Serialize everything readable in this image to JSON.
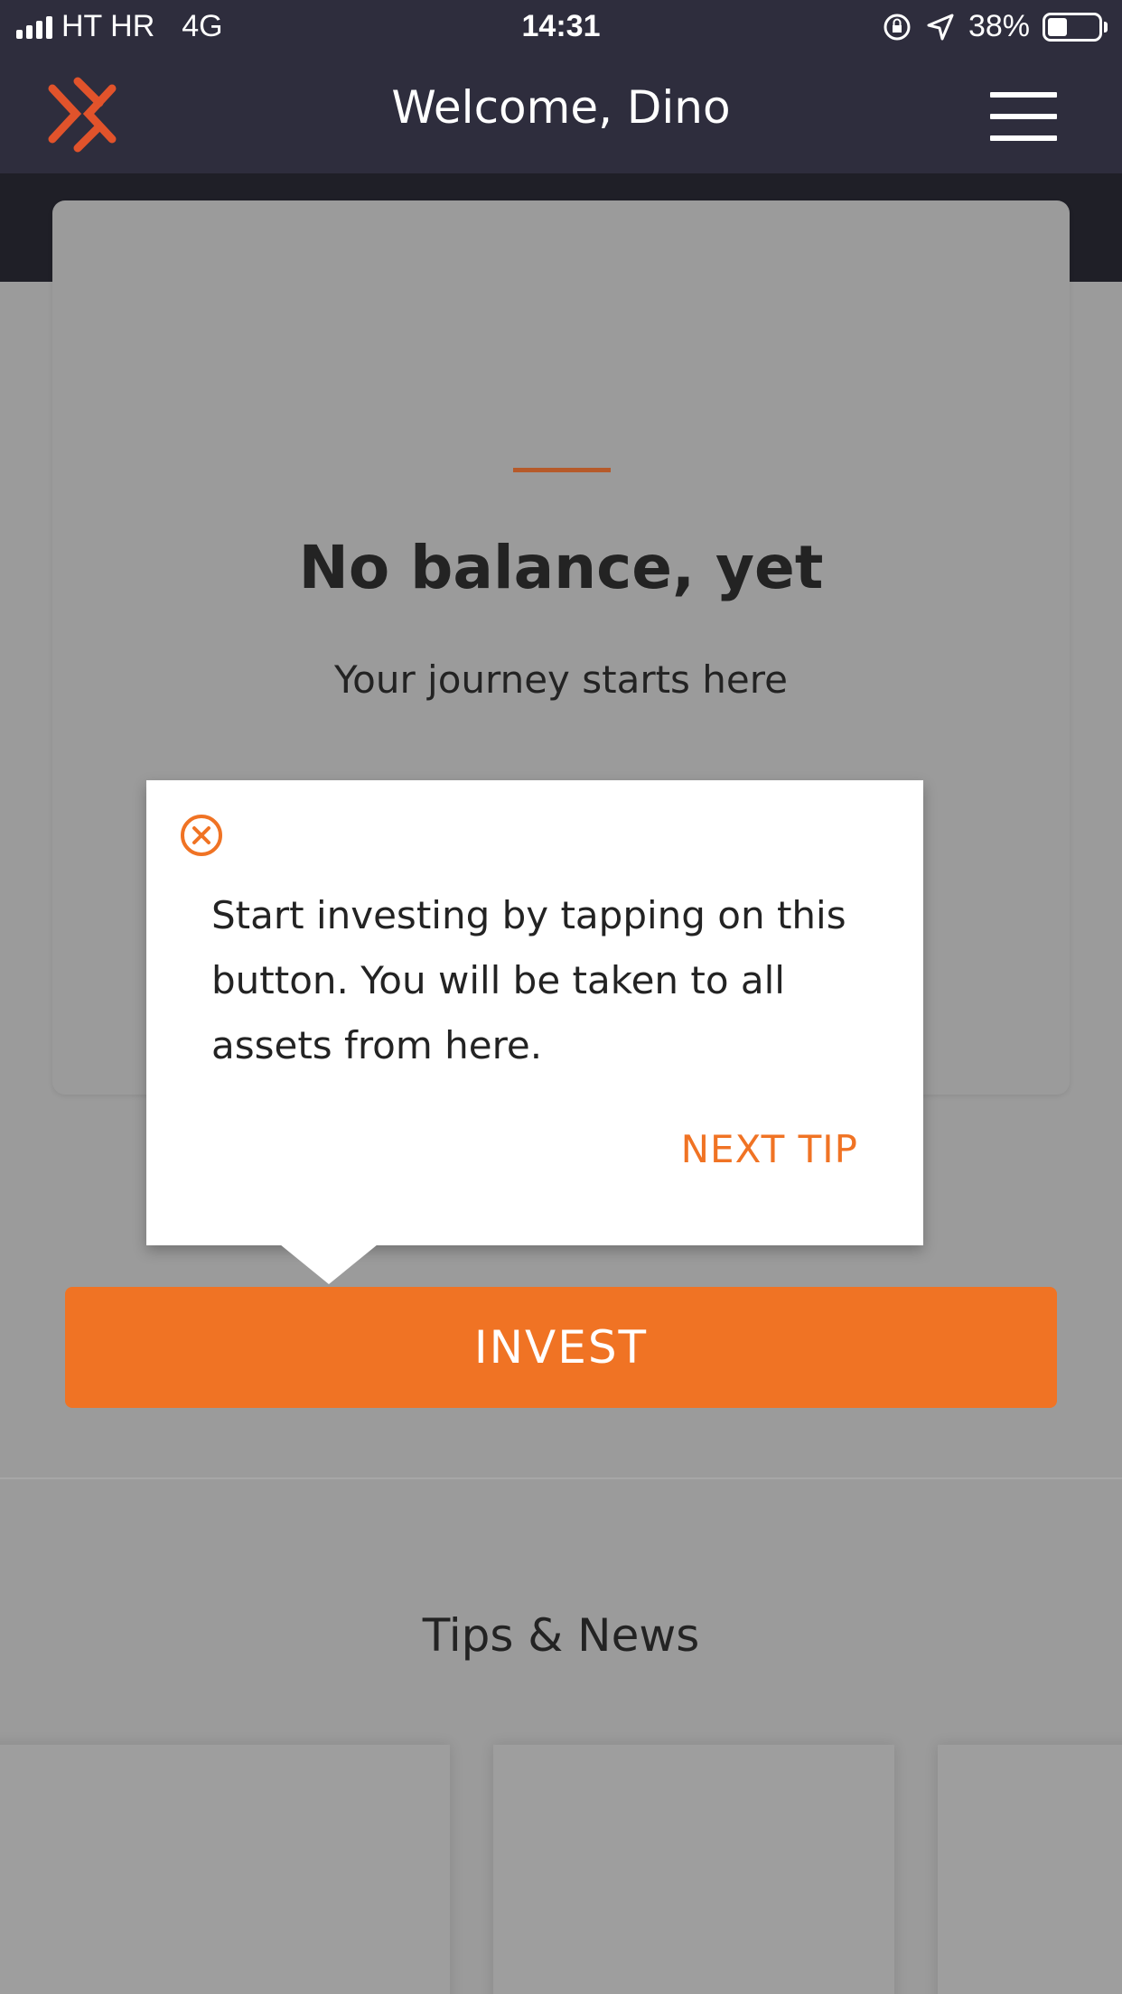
{
  "status_bar": {
    "carrier": "HT HR",
    "network": "4G",
    "time": "14:31",
    "battery": "38%",
    "battery_level": 0.38,
    "icons": [
      "signal-icon",
      "orientation-lock-icon",
      "location-icon",
      "battery-icon"
    ]
  },
  "header": {
    "title": "Welcome, Dino",
    "logo_icon": "brand-logo-icon",
    "menu_icon": "hamburger-menu-icon"
  },
  "balance_card": {
    "title": "No balance, yet",
    "subtitle": "Your journey starts here"
  },
  "tooltip": {
    "text": "Start investing by tapping on this button. You will be taken to all assets from here.",
    "next_label": "NEXT TIP",
    "close_icon": "close-circle-icon"
  },
  "invest_button": {
    "label": "INVEST"
  },
  "tips": {
    "title": "Tips & News"
  },
  "colors": {
    "accent": "#f07324",
    "header_bg": "#2e2d3d",
    "overlay_bg": "#9b9b9b",
    "text_dark": "#232323"
  }
}
